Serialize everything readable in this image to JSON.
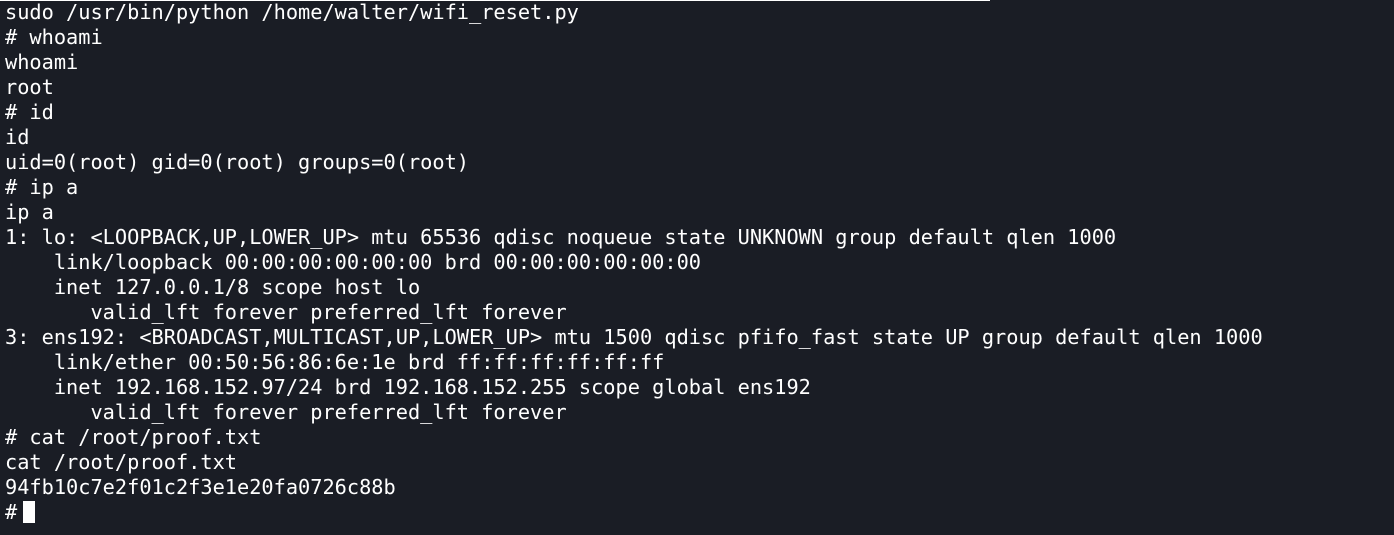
{
  "terminal": {
    "lines": [
      "sudo /usr/bin/python /home/walter/wifi_reset.py",
      "# whoami",
      "whoami",
      "root",
      "# id",
      "id",
      "uid=0(root) gid=0(root) groups=0(root)",
      "# ip a",
      "ip a",
      "1: lo: <LOOPBACK,UP,LOWER_UP> mtu 65536 qdisc noqueue state UNKNOWN group default qlen 1000",
      "    link/loopback 00:00:00:00:00:00 brd 00:00:00:00:00:00",
      "    inet 127.0.0.1/8 scope host lo",
      "       valid_lft forever preferred_lft forever",
      "3: ens192: <BROADCAST,MULTICAST,UP,LOWER_UP> mtu 1500 qdisc pfifo_fast state UP group default qlen 1000",
      "    link/ether 00:50:56:86:6e:1e brd ff:ff:ff:ff:ff:ff",
      "    inet 192.168.152.97/24 brd 192.168.152.255 scope global ens192",
      "       valid_lft forever preferred_lft forever",
      "# cat /root/proof.txt",
      "cat /root/proof.txt",
      "94fb10c7e2f01c2f3e1e20fa0726c88b"
    ],
    "prompt": "#"
  },
  "colors": {
    "background": "#1a1d25",
    "foreground": "#ffffff"
  }
}
